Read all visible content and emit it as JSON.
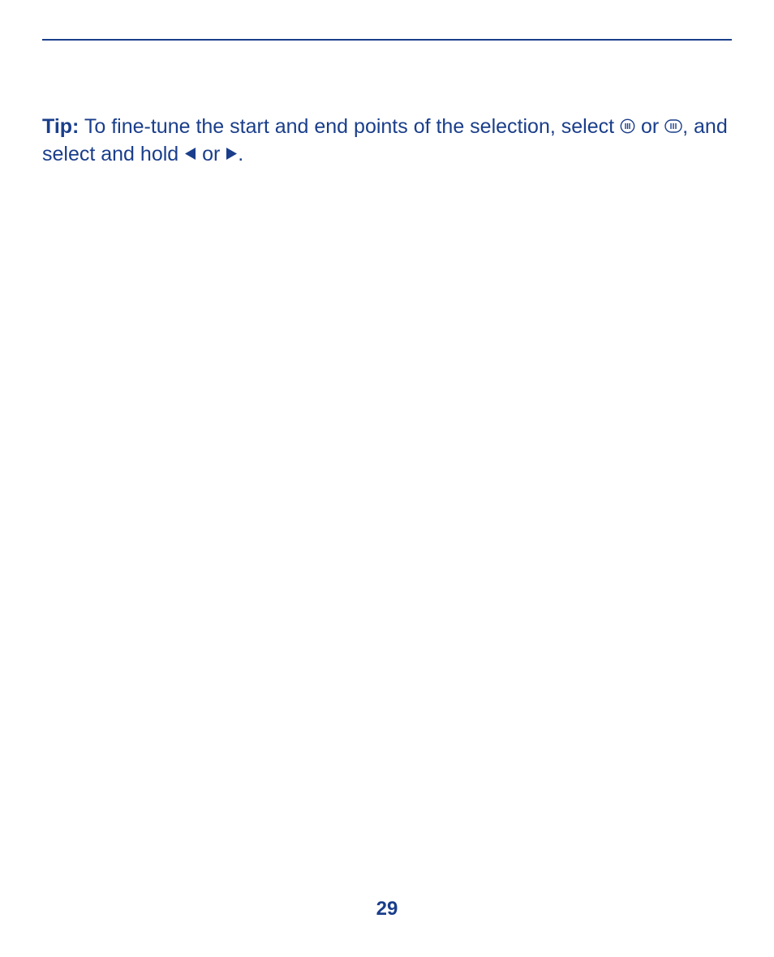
{
  "tip": {
    "label": "Tip:",
    "text_part1": " To fine-tune the start and end points of the selection, select ",
    "text_or1": " or ",
    "text_part2": ", and select and hold ",
    "text_or2": " or ",
    "text_end": "."
  },
  "page_number": "29",
  "colors": {
    "primary": "#1a3e8b"
  }
}
